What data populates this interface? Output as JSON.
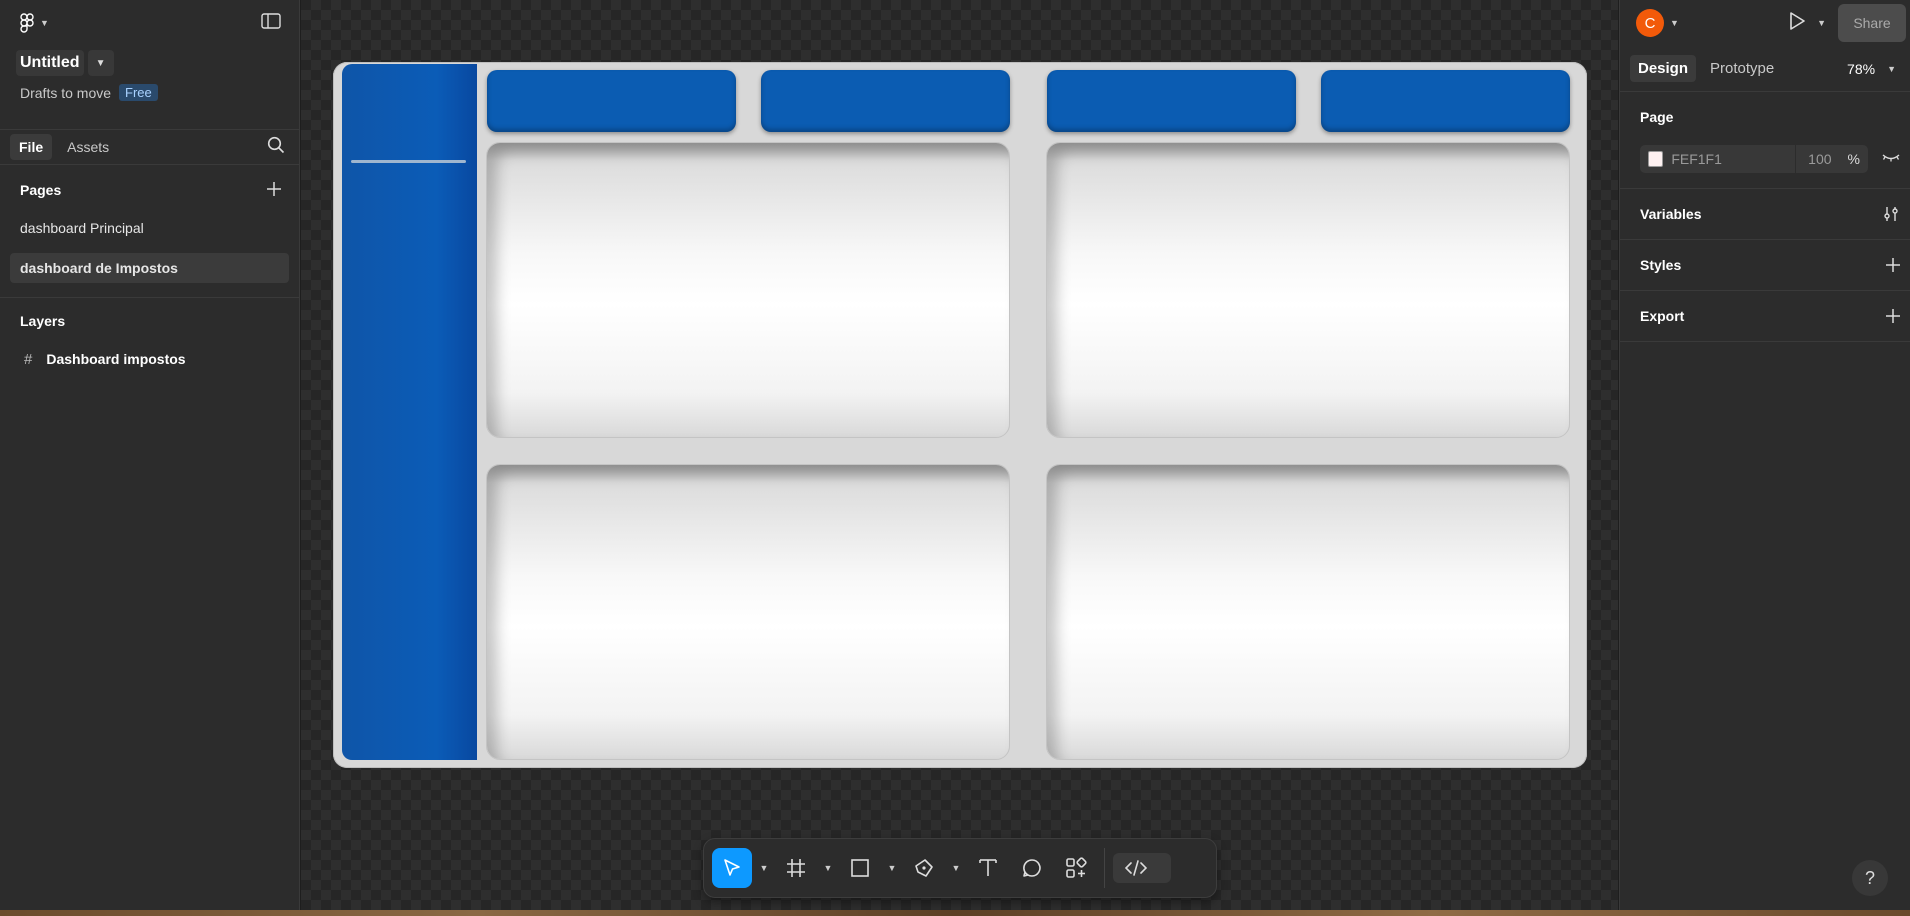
{
  "file": {
    "title": "Untitled",
    "drafts_label": "Drafts to move",
    "plan_badge": "Free"
  },
  "left_tabs": {
    "file": "File",
    "assets": "Assets"
  },
  "pages": {
    "heading": "Pages",
    "items": [
      "dashboard Principal",
      "dashboard de Impostos"
    ],
    "selected": "dashboard de Impostos"
  },
  "layers": {
    "heading": "Layers",
    "items": [
      "Dashboard impostos"
    ]
  },
  "canvas": {
    "frame_name": "",
    "kpi_cards": 4,
    "content_cards": 4,
    "colors": {
      "sidebar_blue": "#0b5cb7",
      "kpi_blue": "#0b5cb2",
      "frame_bg": "#d8d8d8"
    }
  },
  "toolbar": {
    "tools": [
      "move-icon",
      "frame-icon",
      "rectangle-icon",
      "pen-icon",
      "text-icon",
      "comment-icon",
      "actions-icon",
      "dev-mode-icon"
    ],
    "active_tool": "move"
  },
  "header_right": {
    "avatar_initial": "C",
    "share_label": "Share"
  },
  "design_tabs": {
    "design": "Design",
    "prototype": "Prototype",
    "zoom": "78%"
  },
  "page_panel": {
    "heading": "Page",
    "fill_hex": "FEF1F1",
    "opacity": "100",
    "opacity_unit": "%"
  },
  "sections": {
    "variables": "Variables",
    "styles": "Styles",
    "export": "Export"
  },
  "help_label": "?"
}
